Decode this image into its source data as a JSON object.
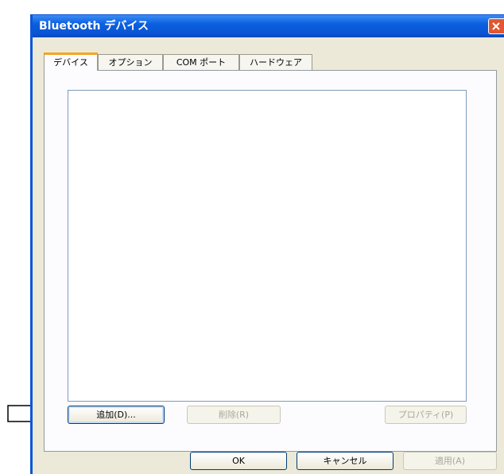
{
  "window": {
    "title": "Bluetooth デバイス"
  },
  "tabs": [
    {
      "label": "デバイス",
      "active": true
    },
    {
      "label": "オプション",
      "active": false
    },
    {
      "label": "COM ポート",
      "active": false
    },
    {
      "label": "ハードウェア",
      "active": false
    }
  ],
  "buttons": {
    "add": "追加(D)...",
    "remove": "削除(R)",
    "properties": "プロパティ(P)",
    "ok": "OK",
    "cancel": "キャンセル",
    "apply": "適用(A)"
  },
  "colors": {
    "titlebar": "#0a5fe0",
    "tab_accent": "#f4a51e",
    "close": "#e2572f"
  },
  "icons": {
    "close": "close-icon",
    "pointer": "arrow-right-icon"
  }
}
